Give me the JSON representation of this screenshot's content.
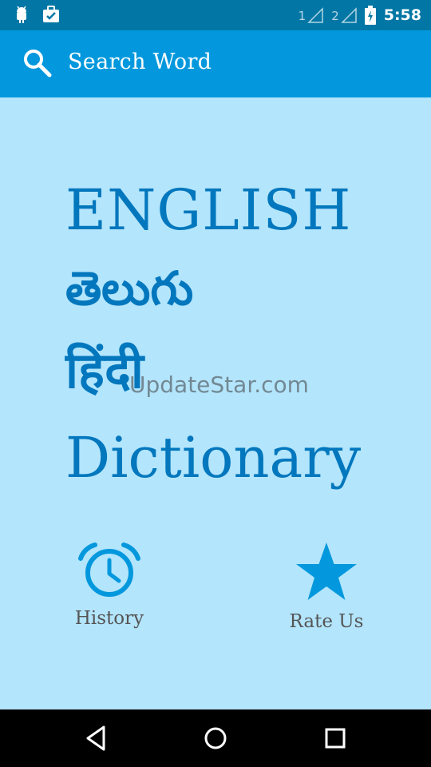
{
  "status_bar": {
    "sim1_label": "1",
    "sim2_label": "2",
    "time": "5:58"
  },
  "app_bar": {
    "search_label": "Search Word",
    "search_icon": "search-icon"
  },
  "title": {
    "line1": "ENGLISH",
    "line2": "తెలుగు",
    "line3": "हिंदी",
    "line4": "Dictionary"
  },
  "watermark": "UpdateStar.com",
  "actions": {
    "history_label": "History",
    "history_icon": "alarm-clock-icon",
    "rate_label": "Rate Us",
    "rate_icon": "star-icon"
  },
  "colors": {
    "status_bar": "#0277a5",
    "app_bar": "#0398dd",
    "background": "#b3e5fc",
    "title_text": "#0277bd",
    "icon_accent": "#0398dd"
  }
}
